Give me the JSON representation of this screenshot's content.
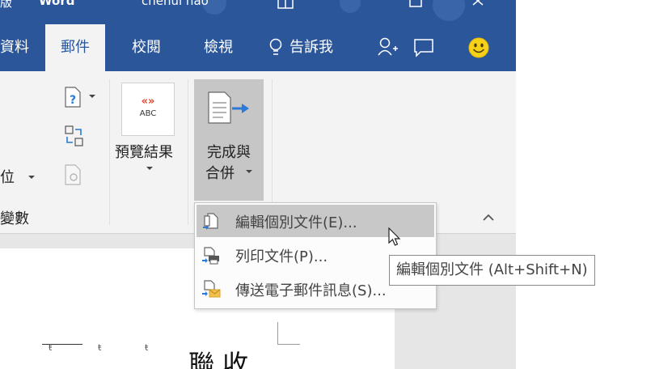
{
  "titlebar": {
    "app_fragment": "Word",
    "user": "chenui hao",
    "left_fragment": "版"
  },
  "tabs": [
    {
      "label": "資料"
    },
    {
      "label": "郵件"
    },
    {
      "label": "校閱"
    },
    {
      "label": "檢視"
    }
  ],
  "tell_me": "告訴我",
  "ribbon": {
    "abc_badge_symbol": "«»",
    "abc_badge_text": "ABC",
    "preview_results": "預覽結果",
    "finish_merge_line1": "完成與",
    "finish_merge_line2": "合併",
    "left_fragment": "位",
    "group_label_fragment": "變數"
  },
  "dropdown": {
    "items": [
      {
        "label": "編輯個別文件(E)...",
        "icon": "edit-documents-icon"
      },
      {
        "label": "列印文件(P)...",
        "icon": "printer-icon"
      },
      {
        "label": "傳送電子郵件訊息(S)...",
        "icon": "email-icon"
      }
    ]
  },
  "tooltip": {
    "text": "編輯個別文件 (Alt+Shift+N)"
  },
  "document": {
    "text": "聯 收",
    "marks": [
      "ŧ",
      "ŧ",
      "ŧ"
    ]
  },
  "colors": {
    "brand": "#2b579a",
    "ribbon_bg": "#f3f3f3",
    "highlight": "#c8c8c8",
    "accent_arrow": "#2b79d8",
    "badge_red": "#e8432c"
  }
}
